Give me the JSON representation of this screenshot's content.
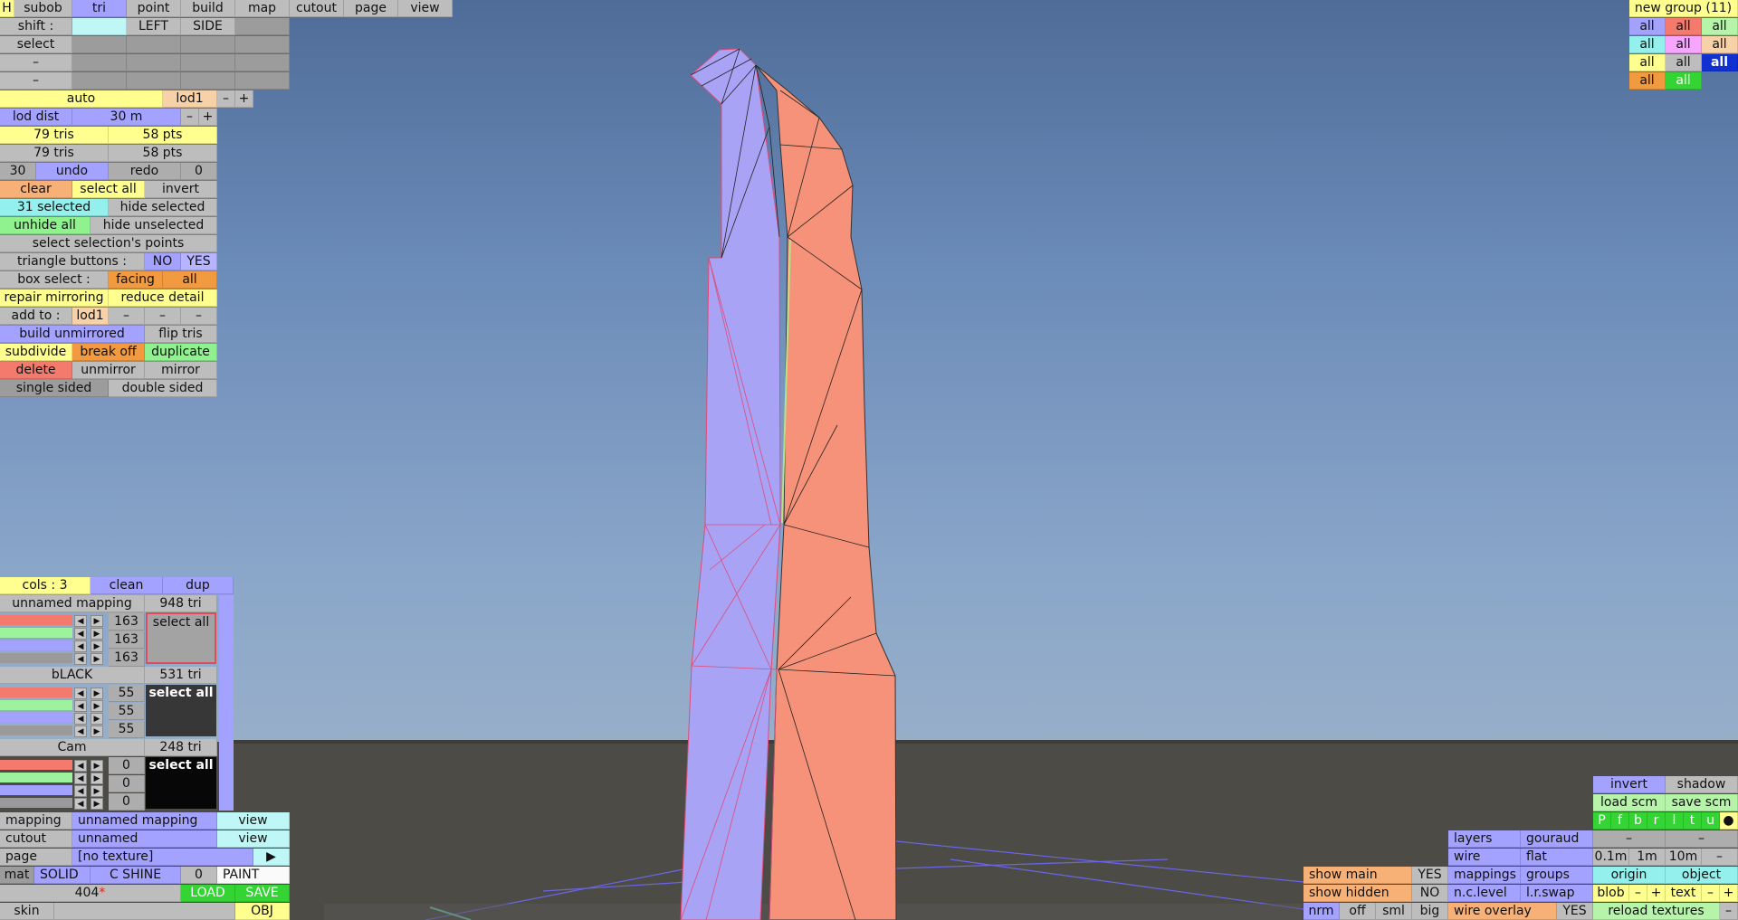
{
  "top_tabs": [
    "H",
    "subob",
    "tri",
    "point",
    "build",
    "map",
    "cutout",
    "page",
    "view"
  ],
  "shift_row": {
    "label": "shift :",
    "left": "LEFT",
    "side": "SIDE"
  },
  "select_label": "select",
  "dash": "–",
  "auto": "auto",
  "lod": {
    "name": "lod1",
    "minus": "–",
    "plus": "+",
    "dist_label": "lod dist",
    "dist_value": "30 m"
  },
  "stats": {
    "tris1": "79 tris",
    "pts1": "58 pts",
    "tris2": "79 tris",
    "pts2": "58 pts"
  },
  "undo_row": {
    "count": "30",
    "undo": "undo",
    "redo": "redo",
    "redo_count": "0"
  },
  "sel_row": {
    "clear": "clear",
    "select_all": "select all",
    "invert": "invert"
  },
  "selected_row": {
    "selected": "31 selected",
    "hide_selected": "hide selected"
  },
  "unhide_row": {
    "unhide_all": "unhide all",
    "hide_unselected": "hide unselected"
  },
  "select_points": "select selection's points",
  "tri_buttons": {
    "label": "triangle buttons :",
    "no": "NO",
    "yes": "YES"
  },
  "box_select": {
    "label": "box select :",
    "facing": "facing",
    "all": "all"
  },
  "repair_row": {
    "repair": "repair mirroring",
    "reduce": "reduce detail"
  },
  "add_to": {
    "label": "add to :",
    "value": "lod1"
  },
  "build_row": {
    "build": "build unmirrored",
    "flip": "flip tris"
  },
  "sub_row": {
    "subdivide": "subdivide",
    "break_off": "break off",
    "duplicate": "duplicate"
  },
  "del_row": {
    "delete": "delete",
    "unmirror": "unmirror",
    "mirror": "mirror"
  },
  "side_row": {
    "single": "single sided",
    "double": "double sided"
  },
  "groups": {
    "title": "new group (11)",
    "all": "all"
  },
  "cols_panel": {
    "cols": "cols : 3",
    "clean": "clean",
    "dup": "dup"
  },
  "materials": [
    {
      "name": "unnamed mapping",
      "tri": "948 tri",
      "rgb": [
        "163",
        "163",
        "163"
      ],
      "select_all": "select all"
    },
    {
      "name": "bLACK",
      "tri": "531 tri",
      "rgb": [
        "55",
        "55",
        "55"
      ],
      "select_all": "select all"
    },
    {
      "name": "Cam",
      "tri": "248 tri",
      "rgb": [
        "0",
        "0",
        "0"
      ],
      "select_all": "select all"
    }
  ],
  "mapping_row": {
    "label": "mapping",
    "value": "unnamed mapping",
    "view": "view"
  },
  "cutout_row": {
    "label": "cutout",
    "value": "unnamed",
    "view": "view"
  },
  "page_row": {
    "label": "page",
    "value": "[no texture]",
    "arrow": "▶"
  },
  "mat_row": {
    "mat": "mat",
    "solid": "SOLID",
    "cshine": "C SHINE",
    "num": "0",
    "paint": "PAINT"
  },
  "load_row": {
    "num": "404",
    "star": "*",
    "load": "LOAD",
    "save": "SAVE"
  },
  "skin_row": {
    "skin": "skin",
    "obj": "OBJ"
  },
  "right_panel": {
    "invert": "invert",
    "shadow": "shadow",
    "load_scm": "load scm",
    "save_scm": "save scm",
    "views": [
      "P",
      "f",
      "b",
      "r",
      "l",
      "t",
      "u",
      "●"
    ],
    "layers": "layers",
    "gouraud": "gouraud",
    "wire": "wire",
    "flat": "flat",
    "d01": "0.1m",
    "d1": "1m",
    "d10": "10m",
    "show_main": "show main",
    "yes": "YES",
    "mappings": "mappings",
    "groups": "groups",
    "origin": "origin",
    "object": "object",
    "show_hidden": "show hidden",
    "no": "NO",
    "nclevel": "n.c.level",
    "lrswap": "l.r.swap",
    "blob": "blob",
    "text": "text",
    "minus": "–",
    "plus": "+",
    "nrm": "nrm",
    "off": "off",
    "sml": "sml",
    "big": "big",
    "wire_overlay": "wire overlay",
    "yes2": "YES",
    "reload": "reload textures"
  },
  "colors": {
    "model_blue": "#a9a3f6",
    "model_salmon": "#f69279",
    "sky": "#6c8cb9",
    "ground": "#4d4b46"
  }
}
